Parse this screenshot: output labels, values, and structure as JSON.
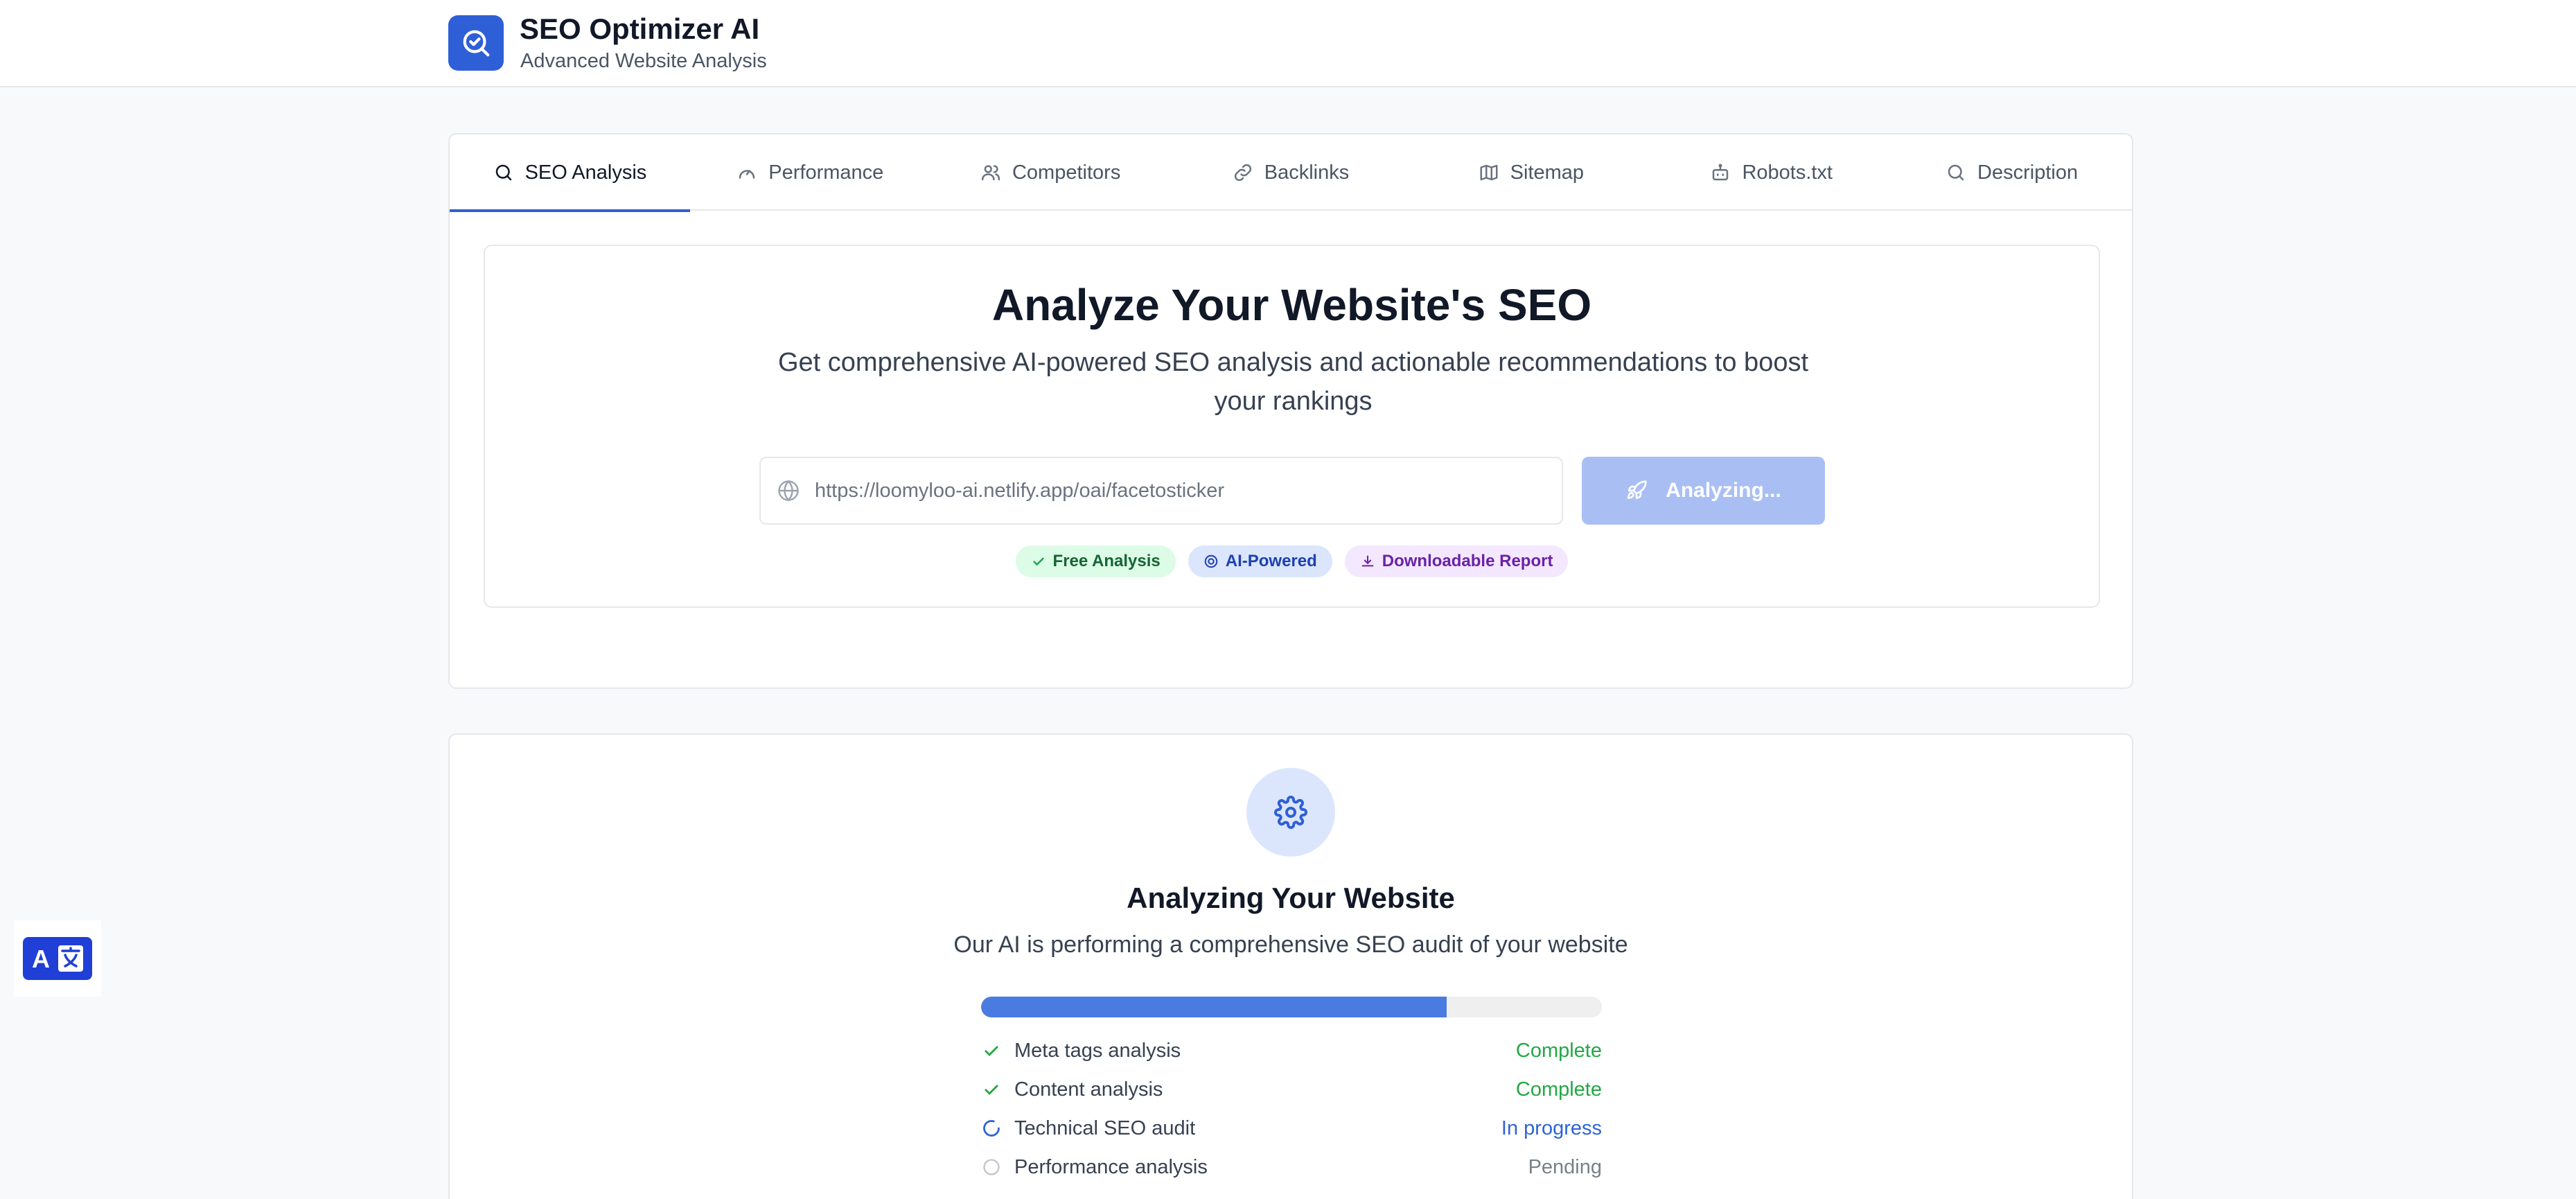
{
  "header": {
    "title": "SEO Optimizer AI",
    "subtitle": "Advanced Website Analysis",
    "logo_icon": "search-check-icon"
  },
  "tabs": [
    {
      "label": "SEO Analysis",
      "icon": "search-icon",
      "active": true
    },
    {
      "label": "Performance",
      "icon": "gauge-icon",
      "active": false
    },
    {
      "label": "Competitors",
      "icon": "users-icon",
      "active": false
    },
    {
      "label": "Backlinks",
      "icon": "link-icon",
      "active": false
    },
    {
      "label": "Sitemap",
      "icon": "map-icon",
      "active": false
    },
    {
      "label": "Robots.txt",
      "icon": "robot-icon",
      "active": false
    },
    {
      "label": "Description",
      "icon": "search-icon",
      "active": false
    }
  ],
  "hero": {
    "title": "Analyze Your Website's SEO",
    "subtitle": "Get comprehensive AI-powered SEO analysis and actionable recommendations to boost your rankings",
    "url_value": "https://loomyloo-ai.netlify.app/oai/facetosticker",
    "button_label": "Analyzing...",
    "badges": [
      {
        "label": "Free Analysis",
        "icon": "check-icon"
      },
      {
        "label": "AI-Powered",
        "icon": "target-icon"
      },
      {
        "label": "Downloadable Report",
        "icon": "download-icon"
      }
    ]
  },
  "progress": {
    "title": "Analyzing Your Website",
    "subtitle": "Our AI is performing a comprehensive SEO audit of your website",
    "percent": 75,
    "steps": [
      {
        "label": "Meta tags analysis",
        "status": "Complete"
      },
      {
        "label": "Content analysis",
        "status": "Complete"
      },
      {
        "label": "Technical SEO audit",
        "status": "In progress"
      },
      {
        "label": "Performance analysis",
        "status": "Pending"
      }
    ]
  },
  "colors": {
    "primary": "#2f5fd7",
    "complete": "#22a845",
    "in_progress": "#2f64d8",
    "pending": "#7a7f87",
    "button_disabled": "#a9bff4"
  },
  "floating": {
    "translate_icon": "translate-icon"
  }
}
